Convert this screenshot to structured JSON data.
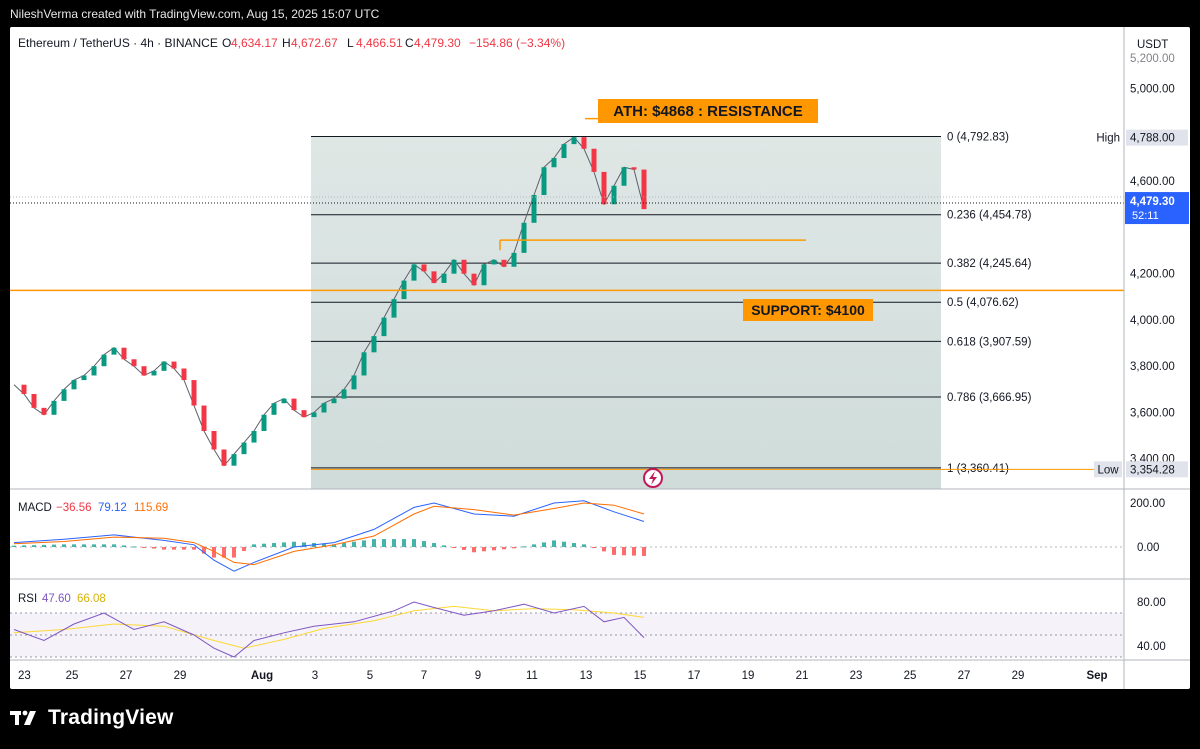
{
  "attribution": "NileshVerma created with TradingView.com, Aug 15, 2025 15:07 UTC",
  "footer_logo": "TradingView",
  "colors": {
    "up": "#089981",
    "down": "#f23645",
    "fib": "#131722",
    "orange": "#ff9800",
    "macd": "#2962ff",
    "signal": "#ff6d00",
    "rsi": "#7e57c2",
    "rsi_ma": "#fdd835"
  },
  "chart_data": {
    "type": "line",
    "symbol_info": {
      "symbol": "Ethereum / TetherUS · 4h · BINANCE",
      "open_label": "O",
      "open": "4,634.17",
      "high_label": "H",
      "high": "4,672.67",
      "low_label": "L",
      "low": "4,466.51",
      "close_label": "C",
      "close": "4,479.30",
      "change": "−154.86 (−3.34%)"
    },
    "currency": "USDT",
    "x_ticks": [
      "23",
      "25",
      "27",
      "29",
      "Aug",
      "3",
      "5",
      "7",
      "9",
      "11",
      "13",
      "15",
      "17",
      "19",
      "21",
      "23",
      "25",
      "27",
      "29",
      "Sep"
    ],
    "y_ticks": [
      "5,000.00",
      "4,600.00",
      "4,200.00",
      "4,000.00",
      "3,800.00",
      "3,600.00",
      "3,400.00"
    ],
    "y_top_partial": "5,200.00",
    "price_path": [
      [
        0,
        3720
      ],
      [
        1,
        3680
      ],
      [
        2,
        3620
      ],
      [
        3,
        3590
      ],
      [
        4,
        3650
      ],
      [
        5,
        3700
      ],
      [
        6,
        3740
      ],
      [
        7,
        3760
      ],
      [
        8,
        3800
      ],
      [
        9,
        3850
      ],
      [
        10,
        3880
      ],
      [
        11,
        3830
      ],
      [
        12,
        3800
      ],
      [
        13,
        3760
      ],
      [
        14,
        3780
      ],
      [
        15,
        3820
      ],
      [
        16,
        3790
      ],
      [
        17,
        3740
      ],
      [
        18,
        3630
      ],
      [
        19,
        3520
      ],
      [
        20,
        3440
      ],
      [
        21,
        3370
      ],
      [
        22,
        3420
      ],
      [
        23,
        3470
      ],
      [
        24,
        3520
      ],
      [
        25,
        3590
      ],
      [
        26,
        3640
      ],
      [
        27,
        3660
      ],
      [
        28,
        3610
      ],
      [
        29,
        3580
      ],
      [
        30,
        3600
      ],
      [
        31,
        3640
      ],
      [
        32,
        3660
      ],
      [
        33,
        3700
      ],
      [
        34,
        3760
      ],
      [
        35,
        3860
      ],
      [
        36,
        3930
      ],
      [
        37,
        4010
      ],
      [
        38,
        4090
      ],
      [
        39,
        4170
      ],
      [
        40,
        4240
      ],
      [
        41,
        4210
      ],
      [
        42,
        4160
      ],
      [
        43,
        4200
      ],
      [
        44,
        4260
      ],
      [
        45,
        4200
      ],
      [
        46,
        4150
      ],
      [
        47,
        4240
      ],
      [
        48,
        4260
      ],
      [
        49,
        4230
      ],
      [
        50,
        4290
      ],
      [
        51,
        4420
      ],
      [
        52,
        4540
      ],
      [
        53,
        4660
      ],
      [
        54,
        4700
      ],
      [
        55,
        4760
      ],
      [
        56,
        4790
      ],
      [
        57,
        4740
      ],
      [
        58,
        4640
      ],
      [
        59,
        4500
      ],
      [
        60,
        4580
      ],
      [
        61,
        4660
      ],
      [
        62,
        4650
      ],
      [
        63,
        4479
      ]
    ],
    "y_range": [
      3150,
      5250
    ],
    "fib_levels": [
      {
        "ratio": "0",
        "price": 4792.83,
        "label": "0 (4,792.83)"
      },
      {
        "ratio": "0.236",
        "price": 4454.78,
        "label": "0.236 (4,454.78)"
      },
      {
        "ratio": "0.382",
        "price": 4245.64,
        "label": "0.382 (4,245.64)"
      },
      {
        "ratio": "0.5",
        "price": 4076.62,
        "label": "0.5 (4,076.62)"
      },
      {
        "ratio": "0.618",
        "price": 3907.59,
        "label": "0.618 (3,907.59)"
      },
      {
        "ratio": "0.786",
        "price": 3666.95,
        "label": "0.786 (3,666.95)"
      },
      {
        "ratio": "1",
        "price": 3360.41,
        "label": "1 (3,360.41)"
      }
    ],
    "annotations": {
      "resistance": "ATH: $4868 : RESISTANCE",
      "support": "SUPPORT: $4100",
      "support_line_price": 4128,
      "resistance_line_price": 4870,
      "mid_line_price": 4345
    },
    "markers": {
      "high_label": "High",
      "high_value": "4,788.00",
      "low_label": "Low",
      "low_value": "3,354.28",
      "current_price": "4,479.30",
      "countdown": "52:11"
    },
    "macd": {
      "label": "MACD",
      "values": [
        "−36.56",
        "79.12",
        "115.69"
      ],
      "y_ticks": [
        "200.00",
        "0.00"
      ],
      "macd_line": [
        [
          0,
          20
        ],
        [
          5,
          35
        ],
        [
          10,
          55
        ],
        [
          15,
          30
        ],
        [
          18,
          10
        ],
        [
          20,
          -60
        ],
        [
          22,
          -110
        ],
        [
          24,
          -70
        ],
        [
          28,
          0
        ],
        [
          32,
          20
        ],
        [
          36,
          80
        ],
        [
          40,
          180
        ],
        [
          42,
          200
        ],
        [
          46,
          150
        ],
        [
          50,
          140
        ],
        [
          54,
          200
        ],
        [
          57,
          210
        ],
        [
          60,
          160
        ],
        [
          63,
          116
        ]
      ],
      "signal_line": [
        [
          0,
          15
        ],
        [
          5,
          25
        ],
        [
          10,
          45
        ],
        [
          15,
          40
        ],
        [
          18,
          20
        ],
        [
          20,
          -20
        ],
        [
          22,
          -70
        ],
        [
          24,
          -80
        ],
        [
          28,
          -20
        ],
        [
          32,
          10
        ],
        [
          36,
          50
        ],
        [
          40,
          150
        ],
        [
          42,
          185
        ],
        [
          46,
          170
        ],
        [
          50,
          145
        ],
        [
          54,
          175
        ],
        [
          57,
          200
        ],
        [
          60,
          190
        ],
        [
          63,
          150
        ]
      ]
    },
    "rsi": {
      "label": "RSI",
      "values": [
        "47.60",
        "66.08"
      ],
      "y_ticks": [
        "80.00",
        "40.00"
      ],
      "rsi_line": [
        [
          0,
          55
        ],
        [
          3,
          45
        ],
        [
          6,
          60
        ],
        [
          9,
          70
        ],
        [
          12,
          55
        ],
        [
          15,
          62
        ],
        [
          18,
          50
        ],
        [
          20,
          38
        ],
        [
          22,
          30
        ],
        [
          24,
          45
        ],
        [
          27,
          52
        ],
        [
          30,
          58
        ],
        [
          34,
          62
        ],
        [
          38,
          72
        ],
        [
          40,
          80
        ],
        [
          42,
          75
        ],
        [
          45,
          68
        ],
        [
          48,
          72
        ],
        [
          51,
          78
        ],
        [
          54,
          70
        ],
        [
          57,
          76
        ],
        [
          59,
          62
        ],
        [
          61,
          66
        ],
        [
          63,
          47.6
        ]
      ],
      "rsi_ma": [
        [
          0,
          52
        ],
        [
          5,
          55
        ],
        [
          10,
          60
        ],
        [
          15,
          58
        ],
        [
          20,
          45
        ],
        [
          23,
          38
        ],
        [
          27,
          46
        ],
        [
          31,
          56
        ],
        [
          36,
          63
        ],
        [
          40,
          72
        ],
        [
          44,
          76
        ],
        [
          48,
          72
        ],
        [
          52,
          74
        ],
        [
          56,
          73
        ],
        [
          60,
          70
        ],
        [
          63,
          66
        ]
      ]
    }
  }
}
